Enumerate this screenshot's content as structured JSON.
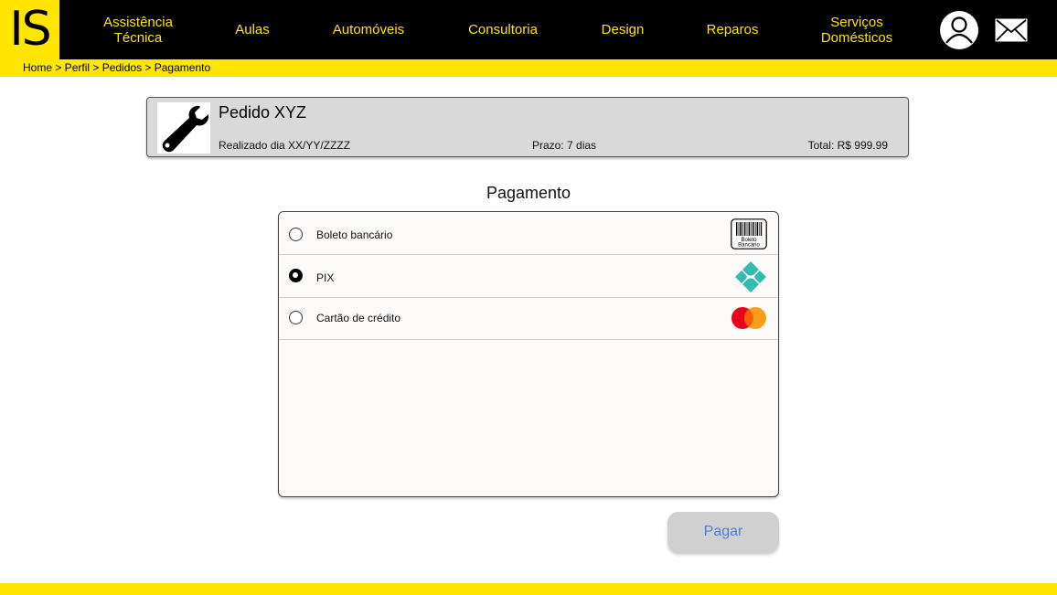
{
  "header": {
    "logo": "IS",
    "nav": [
      {
        "line1": "Assistência",
        "line2": "Técnica"
      },
      {
        "line1": "Aulas",
        "line2": ""
      },
      {
        "line1": "Automóveis",
        "line2": ""
      },
      {
        "line1": "Consultoria",
        "line2": ""
      },
      {
        "line1": "Design",
        "line2": ""
      },
      {
        "line1": "Reparos",
        "line2": ""
      },
      {
        "line1": "Serviços",
        "line2": "Domésticos"
      }
    ],
    "icons": {
      "profile": "user-icon",
      "messages": "mail-icon"
    }
  },
  "breadcrumb": "Home > Perfil > Pedidos > Pagamento",
  "order": {
    "icon": "wrench-icon",
    "title": "Pedido XYZ",
    "date": "Realizado dia XX/YY/ZZZZ",
    "deadline": "Prazo: 7 dias",
    "total": "Total: R$ 999.99"
  },
  "payment": {
    "heading": "Pagamento",
    "options": [
      {
        "label": "Boleto bancário",
        "selected": false,
        "icon": "boleto-icon",
        "icon_text_1": "Boleto",
        "icon_text_2": "Bancário"
      },
      {
        "label": "PIX",
        "selected": true,
        "icon": "pix-icon"
      },
      {
        "label": "Cartão de crédito",
        "selected": false,
        "icon": "mastercard-icon"
      }
    ],
    "button": "Pagar"
  },
  "colors": {
    "brand_yellow": "#ffe500",
    "header_bg": "#000000",
    "pix_teal": "#32bcad",
    "mc_red": "#eb001b",
    "mc_orange": "#f79e1b",
    "button_text": "#4a7fd4"
  }
}
